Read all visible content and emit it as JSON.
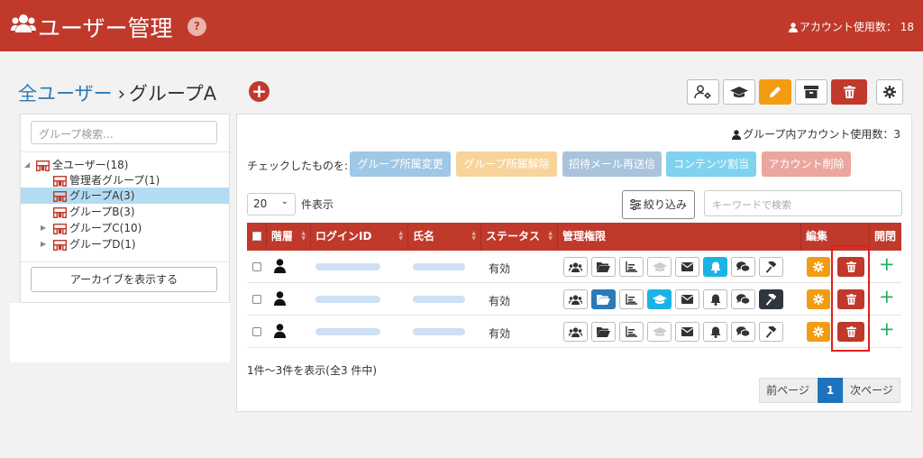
{
  "header": {
    "title": "ユーザー管理",
    "help": "?",
    "account_usage": "アカウント使用数：",
    "account_count": "18",
    "bg_color": "#c0392b"
  },
  "breadcrumb": {
    "root": "全ユーザー",
    "separator": "›",
    "current": "グループA",
    "add_icon": "plus-circle-icon"
  },
  "toolbar": {
    "icons": [
      "user-settings-icon",
      "graduation-cap-icon",
      "pencil-icon",
      "archive-icon",
      "trash-icon",
      "gear-icon"
    ]
  },
  "sidebar": {
    "search_placeholder": "グループ検索...",
    "tree": [
      {
        "label": "全ユーザー(18)",
        "level": 0,
        "expanded": true
      },
      {
        "label": "管理者グループ(1)",
        "level": 1
      },
      {
        "label": "グループA(3)",
        "level": 1,
        "selected": true
      },
      {
        "label": "グループB(3)",
        "level": 1
      },
      {
        "label": "グループC(10)",
        "level": 1,
        "collapsed": true
      },
      {
        "label": "グループD(1)",
        "level": 1,
        "collapsed": true
      }
    ],
    "archive_button": "アーカイブを表示する"
  },
  "main": {
    "group_account_usage": "グループ内アカウント使用数：3",
    "checked_label": "チェックしたものを:",
    "bulk_actions": [
      {
        "label": "グループ所属変更",
        "color": "#9fc7e6"
      },
      {
        "label": "グループ所属解除",
        "color": "#f8d49b"
      },
      {
        "label": "招待メール再送信",
        "color": "#a9c3dc"
      },
      {
        "label": "コンテンツ割当",
        "color": "#7fd3ee"
      },
      {
        "label": "アカウント削除",
        "color": "#eba79f"
      }
    ],
    "per_page": "20",
    "per_page_label": "件表示",
    "filter_button": "絞り込み",
    "keyword_placeholder": "キーワードで検索",
    "columns": [
      "階層",
      "ログインID",
      "氏名",
      "ステータス",
      "管理権限",
      "編集",
      "開閉"
    ],
    "rows": [
      {
        "status": "有効",
        "perms": [
          "white",
          "white",
          "white",
          "disabled",
          "white",
          "cyan",
          "white",
          "white"
        ]
      },
      {
        "status": "有効",
        "perms": [
          "white",
          "blue",
          "white",
          "cyan",
          "white",
          "white",
          "white",
          "dark"
        ]
      },
      {
        "status": "有効",
        "perms": [
          "white",
          "white",
          "white",
          "disabled",
          "white",
          "white",
          "white",
          "white"
        ]
      }
    ],
    "perm_icons": [
      "users-icon",
      "folder-open-icon",
      "bar-chart-icon",
      "graduation-cap-icon",
      "envelope-icon",
      "bell-icon",
      "comments-icon",
      "gavel-icon"
    ],
    "summary": "1件〜3件を表示(全3 件中)",
    "pager": {
      "prev": "前ページ",
      "current": "1",
      "next": "次ページ"
    }
  }
}
